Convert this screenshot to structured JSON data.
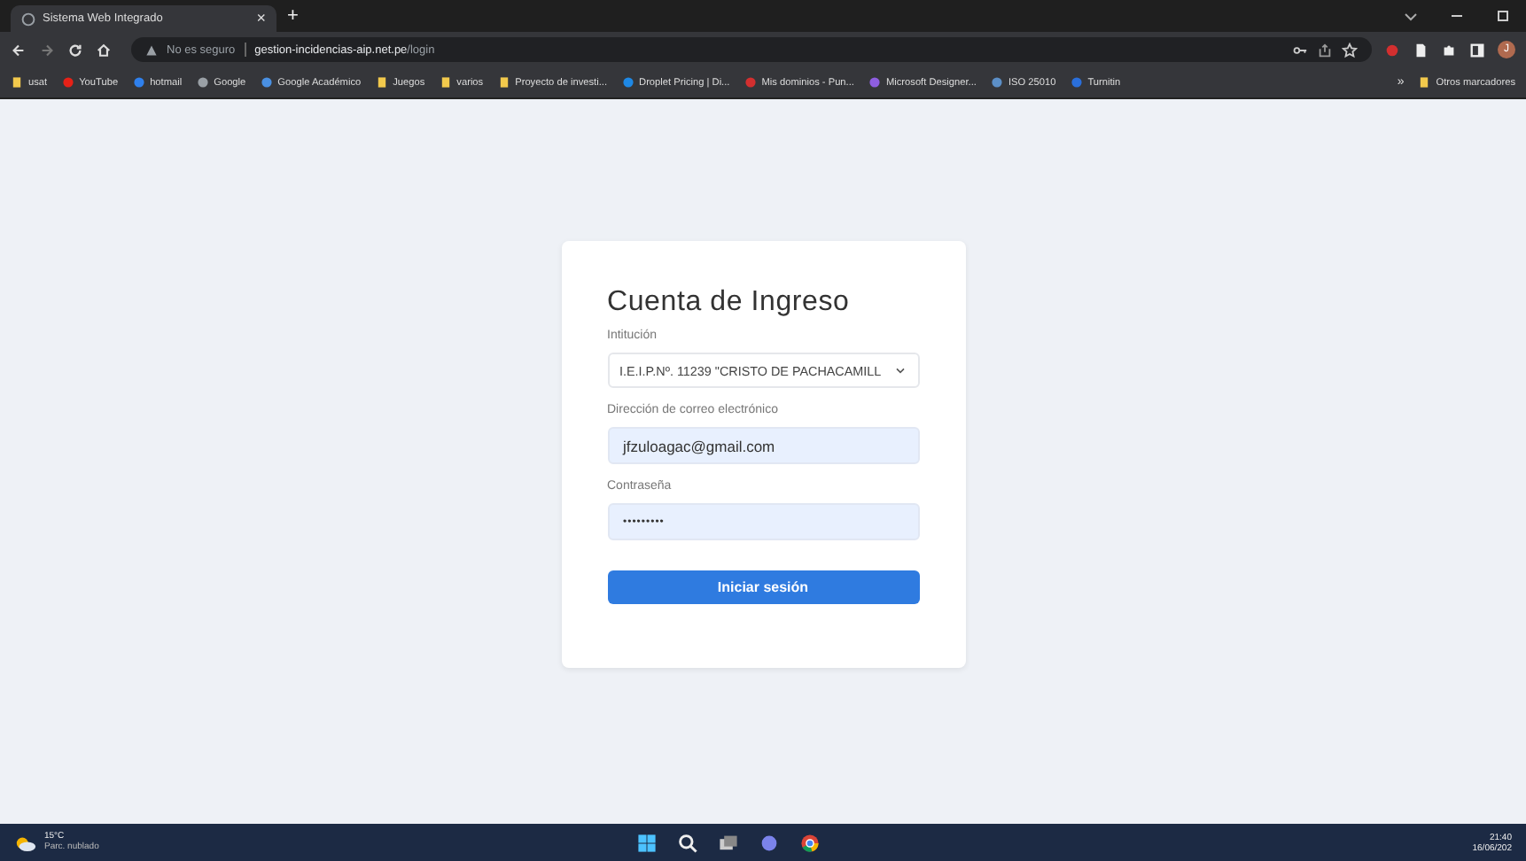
{
  "tab": {
    "title": "Sistema Web Integrado",
    "close": "×",
    "new_tab": "+"
  },
  "address": {
    "warning": "No es seguro",
    "host": "gestion-incidencias-aip.net.pe",
    "path": "/login"
  },
  "bookmarks": [
    {
      "label": "usat",
      "kind": "folder",
      "color": "#f2c94c"
    },
    {
      "label": "YouTube",
      "kind": "site",
      "color": "#e62117"
    },
    {
      "label": "hotmail",
      "kind": "site",
      "color": "#2f80ed"
    },
    {
      "label": "Google",
      "kind": "site",
      "color": "#9aa0a6"
    },
    {
      "label": "Google Académico",
      "kind": "site",
      "color": "#4a90e2"
    },
    {
      "label": "Juegos",
      "kind": "folder",
      "color": "#f2c94c"
    },
    {
      "label": "varios",
      "kind": "folder",
      "color": "#f2c94c"
    },
    {
      "label": "Proyecto de investi...",
      "kind": "folder",
      "color": "#f2c94c"
    },
    {
      "label": "Droplet Pricing | Di...",
      "kind": "site",
      "color": "#1e88e5"
    },
    {
      "label": "Mis dominios - Pun...",
      "kind": "site",
      "color": "#d32f2f"
    },
    {
      "label": "Microsoft Designer...",
      "kind": "site",
      "color": "#8e5ee0"
    },
    {
      "label": "ISO 25010",
      "kind": "site",
      "color": "#5c8fc7"
    },
    {
      "label": "Turnitin",
      "kind": "site",
      "color": "#2a6fdb"
    }
  ],
  "bookmarks_more": "»",
  "other_bookmarks": "Otros marcadores",
  "profile": "J",
  "form": {
    "title": "Cuenta de Ingreso",
    "institution_label": "Intitución",
    "institution_value": "I.E.I.P.Nº. 11239 \"CRISTO DE PACHACAMILL",
    "email_label": "Dirección de correo electrónico",
    "email_value": "jfzuloagac@gmail.com",
    "password_label": "Contraseña",
    "password_value": "•••••••••",
    "submit": "Iniciar sesión"
  },
  "taskbar": {
    "temperature": "15°C",
    "weather": "Parc. nublado",
    "time": "21:40",
    "date": "16/06/202"
  }
}
